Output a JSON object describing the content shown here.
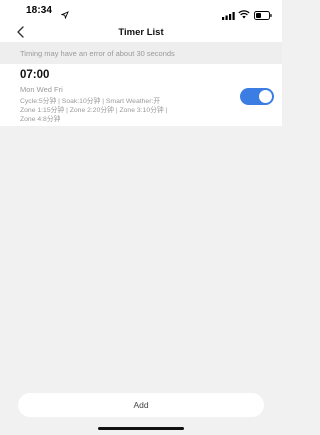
{
  "status_bar": {
    "time": "18:34",
    "location_icon": "location-arrow-icon",
    "signal_icon": "cellular-signal-icon",
    "wifi_icon": "wifi-icon",
    "battery_icon": "battery-icon"
  },
  "nav": {
    "title": "Timer List",
    "back_icon": "chevron-left-icon"
  },
  "notice": "Timing may have an error of about 30 seconds",
  "timers": [
    {
      "time": "07:00",
      "days": "Mon Wed Fri",
      "detail_lines": [
        "Cycle:5分钟 | Soak:10分钟 | Smart Weather:开",
        "Zone 1:15分钟 | Zone 2:20分钟 | Zone 3:10分钟 |",
        "Zone 4:8分钟"
      ],
      "enabled": true
    }
  ],
  "add_label": "Add",
  "colors": {
    "accent": "#3b7de3",
    "background": "#f1f1f1",
    "card": "#ffffff",
    "muted_text": "#9a9a9a"
  }
}
